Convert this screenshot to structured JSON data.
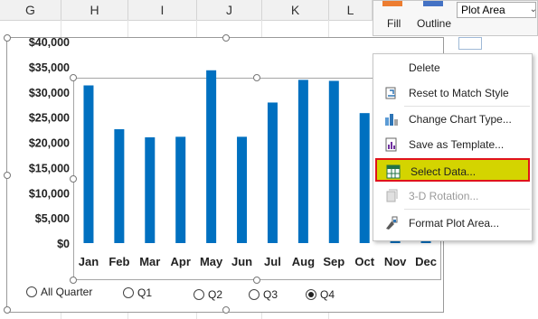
{
  "columns": [
    "G",
    "H",
    "I",
    "J",
    "K",
    "L"
  ],
  "ribbon": {
    "fill_label": "Fill",
    "outline_label": "Outline",
    "selection": "Plot Area"
  },
  "chart_data": {
    "type": "bar",
    "categories": [
      "Jan",
      "Feb",
      "Mar",
      "Apr",
      "May",
      "Jun",
      "Jul",
      "Aug",
      "Sep",
      "Oct",
      "Nov",
      "Dec"
    ],
    "values": [
      31300,
      22600,
      21000,
      21100,
      34300,
      21100,
      27900,
      32400,
      32200,
      25800,
      18000,
      17000
    ],
    "y_tick_labels": [
      "$0",
      "$5,000",
      "$10,000",
      "$15,000",
      "$20,000",
      "$25,000",
      "$30,000",
      "$35,000",
      "$40,000"
    ],
    "ylim": [
      0,
      40000
    ],
    "bar_color": "#0070c0",
    "grid": false
  },
  "radios": {
    "all_quarter": "All Quarter",
    "q1": "Q1",
    "q2": "Q2",
    "q3": "Q3",
    "q4": "Q4",
    "selected": "Q4"
  },
  "context_menu": {
    "delete": "Delete",
    "reset": "Reset to Match Style",
    "change_chart_type": "Change Chart Type...",
    "save_template": "Save as Template...",
    "select_data": "Select Data...",
    "rotation": "3-D Rotation...",
    "format_plot_area": "Format Plot Area..."
  }
}
